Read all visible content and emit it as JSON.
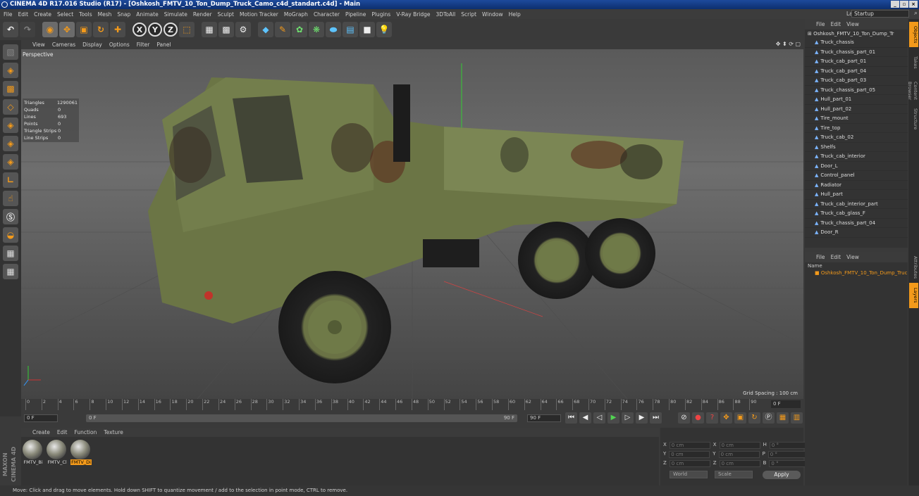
{
  "title": "CINEMA 4D R17.016 Studio (R17) - [Oshkosh_FMTV_10_Ton_Dump_Truck_Camo_c4d_standart.c4d] - Main",
  "menu": [
    "File",
    "Edit",
    "Create",
    "Select",
    "Tools",
    "Mesh",
    "Snap",
    "Animate",
    "Simulate",
    "Render",
    "Sculpt",
    "Motion Tracker",
    "MoGraph",
    "Character",
    "Pipeline",
    "Plugins",
    "V-Ray Bridge",
    "3DToAll",
    "Script",
    "Window",
    "Help"
  ],
  "layout": {
    "label": "Layout:",
    "value": "Startup"
  },
  "viewport": {
    "menu": [
      "View",
      "Cameras",
      "Display",
      "Options",
      "Filter",
      "Panel"
    ],
    "camera": "Perspective",
    "grid_spacing": "Grid Spacing : 100 cm",
    "stats": [
      [
        "Triangles",
        "1290061"
      ],
      [
        "Quads",
        "0"
      ],
      [
        "Lines",
        "693"
      ],
      [
        "Points",
        "0"
      ],
      [
        "Triangle Strips",
        "0"
      ],
      [
        "Line Strips",
        "0"
      ]
    ]
  },
  "timeline": {
    "ticks": [
      "0",
      "2",
      "4",
      "6",
      "8",
      "10",
      "12",
      "14",
      "16",
      "18",
      "20",
      "22",
      "24",
      "26",
      "28",
      "30",
      "32",
      "34",
      "36",
      "38",
      "40",
      "42",
      "44",
      "46",
      "48",
      "50",
      "52",
      "54",
      "56",
      "58",
      "60",
      "62",
      "64",
      "66",
      "68",
      "70",
      "72",
      "74",
      "76",
      "78",
      "80",
      "82",
      "84",
      "86",
      "88",
      "90"
    ],
    "frame": "0 F",
    "start": "0 F",
    "bar_start": "0 F",
    "bar_end": "90 F",
    "end": "90 F"
  },
  "materials": {
    "menu": [
      "Create",
      "Edit",
      "Function",
      "Texture"
    ],
    "items": [
      "FMTV_Bi",
      "FMTV_Cl",
      "FMTV_Di"
    ]
  },
  "coords": {
    "rows": [
      [
        "X",
        "0 cm",
        "X",
        "0 cm",
        "H",
        "0 °"
      ],
      [
        "Y",
        "0 cm",
        "Y",
        "0 cm",
        "P",
        "0 °"
      ],
      [
        "Z",
        "0 cm",
        "Z",
        "0 cm",
        "B",
        "0 °"
      ]
    ],
    "mode": "World",
    "scale": "Scale",
    "apply": "Apply"
  },
  "objects": {
    "menu": [
      "File",
      "Edit",
      "View"
    ],
    "root": "Oshkosh_FMTV_10_Ton_Dump_Tr",
    "items": [
      "Truck_chassis",
      "Truck_chassis_part_01",
      "Truck_cab_part_01",
      "Truck_cab_part_04",
      "Truck_cab_part_03",
      "Truck_chassis_part_05",
      "Hull_part_01",
      "Hull_part_02",
      "Tire_mount",
      "Tire_top",
      "Truck_cab_02",
      "Shelfs",
      "Truck_cab_interior",
      "Door_L",
      "Control_panel",
      "Radiator",
      "Hull_part",
      "Truck_cab_interior_part",
      "Truck_cab_glass_F",
      "Truck_chassis_part_04",
      "Door_R"
    ]
  },
  "attributes": {
    "menu": [
      "File",
      "Edit",
      "View"
    ],
    "name_label": "Name",
    "layer": "Oshkosh_FMTV_10_Ton_Dump_Truc"
  },
  "side_tabs": [
    "Objects",
    "Takes",
    "Content Browser",
    "Structure"
  ],
  "side_tabs2": [
    "Attributes",
    "Layers"
  ],
  "status": "Move: Click and drag to move elements. Hold down SHIFT to quantize movement / add to the selection in point mode, CTRL to remove.",
  "maxon": "MAXON CINEMA 4D"
}
